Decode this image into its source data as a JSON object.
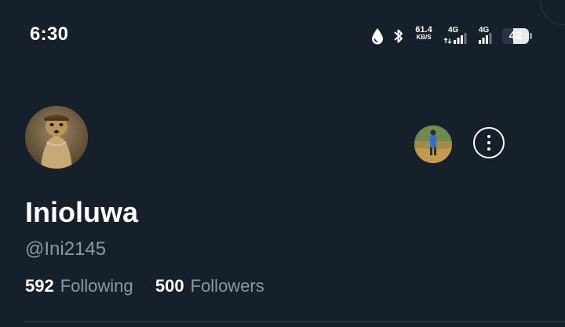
{
  "status_bar": {
    "time": "6:30",
    "net_speed_value": "61.4",
    "net_speed_unit": "KB/S",
    "signal1_label": "4G",
    "signal2_label": "4G",
    "battery_level": "42",
    "icons": [
      "water-drop-icon",
      "bluetooth-icon"
    ]
  },
  "profile": {
    "name": "Inioluwa",
    "handle": "@Ini2145",
    "following_count": "592",
    "following_label": "Following",
    "followers_count": "500",
    "followers_label": "Followers"
  },
  "colors": {
    "background": "#15202b",
    "primary_text": "#ffffff",
    "secondary_text": "#8b98a5",
    "divider": "#38444d"
  }
}
